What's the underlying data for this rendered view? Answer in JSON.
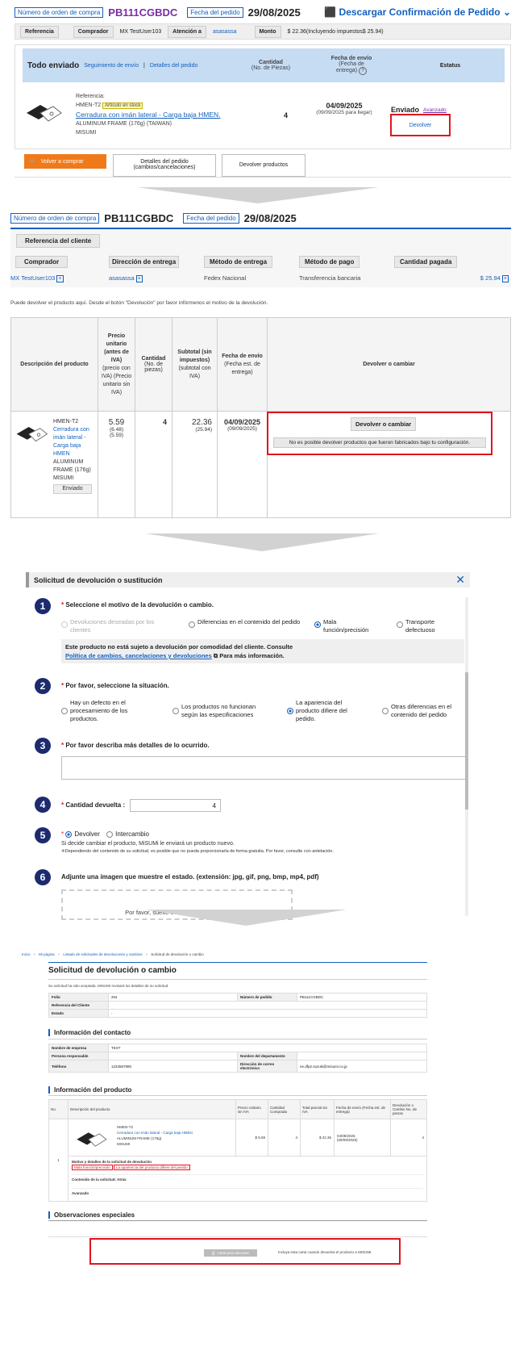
{
  "s1": {
    "order_no_label": "Número de orden de compra",
    "order_no": "PB111CGBDC",
    "order_date_label": "Fecha del pedido",
    "order_date": "29/08/2025",
    "download_label": "Descargar Confirmación de Pedido",
    "ref_label": "Referencia",
    "buyer_label": "Comprador",
    "buyer": "MX TestUser103",
    "attention_label": "Atención a",
    "attention": "asasassa",
    "amount_label": "Monto",
    "amount": "$ 22.36(Incluyendo impuestos$ 25.94)",
    "all_sent": "Todo enviado",
    "tracking": "Seguimiento de envío",
    "sep": "|",
    "details": "Detalles del pedido",
    "qty_h1": "Cantidad",
    "qty_h2": "(No. de Piezas)",
    "ship_h1": "Fecha de envío",
    "ship_h2": "(Fecha de",
    "ship_h3": "entrega)",
    "status_h": "Estatus",
    "ref_text": "Referencia:",
    "code": "HMEN-T2",
    "stock": "Artículo en stock",
    "name": "Cerradura con imán lateral - Carga baja HMEN.",
    "spec": "ALUMINUM FRAME (176g) (TAIWAN)",
    "maker": "MISUMI",
    "qty": "4",
    "ship": "04/09/2025",
    "ship_sub": "(09/09/2025 para llegar)",
    "status": "Enviado",
    "advanced": "Avanzado",
    "return_link": "Devolver",
    "rebuy": "Volver a comprar",
    "order_details_btn": "Detalles del pedido (cambios/cancelaciones)",
    "return_btn": "Devolver productos"
  },
  "s2": {
    "order_no_label": "Número de orden de compra",
    "order_no": "PB111CGBDC",
    "order_date_label": "Fecha del pedido",
    "order_date": "29/08/2025",
    "client_ref": "Referencia del cliente",
    "cols": [
      "Comprador",
      "Dirección de entrega",
      "Método de entrega",
      "Método de pago",
      "Cantidad pagada"
    ],
    "vals": [
      "MX TestUser103",
      "asasassa",
      "Fedex Nacional",
      "Transferencia bancaria",
      "$ 25.94"
    ],
    "note": "Puede devolver el producto aquí. Desde el botón \"Devolución\" por favor infórmenos el motivo de la devolución.",
    "h_desc": "Descripción del producto",
    "h_price": "Precio unitario (antes de IVA)",
    "h_price_sub": "(precio con IVA) (Precio unitario sin IVA)",
    "h_qty": "Cantidad",
    "h_qty_sub": "(No. de piezas)",
    "h_sub": "Subtotal (sin impuestos)",
    "h_sub_sub": "(subtotal con IVA)",
    "h_ship": "Fecha de envío",
    "h_ship_sub": "(Fecha est. de entrega)",
    "h_ret": "Devolver o cambiar",
    "code": "HMEN-T2",
    "name": "Cerradura con imán lateral - Carga baja HMEN",
    "spec": "ALUMINUM FRAME (176g)",
    "maker": "MISUMI",
    "sent": "Enviado",
    "price": "5.59",
    "price_a": "(6.48)",
    "price_b": "(5.59)",
    "qty": "4",
    "sub": "22.36",
    "sub_a": "(25.94)",
    "ship": "04/09/2025",
    "ship_a": "(09/09/2025)",
    "ret_btn": "Devolver o cambiar",
    "ret_msg": "No es posible devolver productos que fueron fabricados bajo tu configuración."
  },
  "s3": {
    "title": "Solicitud de devolución o sustitución",
    "q1": "Seleccione el motivo de la devolución o cambio.",
    "q1_opts": [
      "Devoluciones deseadas por los clientes",
      "Diferencias en el contenido del pedido",
      "Mala función/precisión",
      "Transporte defectuoso"
    ],
    "notice1": "Este producto no está sujeto a devolución por comodidad del cliente. Consulte",
    "notice_link": "Política de cambios, cancelaciones y devoluciones",
    "notice2": "Para más información.",
    "q2": "Por favor, seleccione la situación.",
    "q2_opts": [
      "Hay un defecto en el procesamiento de los productos.",
      "Los productos no funcionan según las especificaciones",
      "La apariencia del producto difiere del pedido.",
      "Otras diferencias en el contenido del pedido"
    ],
    "q3": "Por favor describa más detalles de lo ocurrido.",
    "q4": "Cantidad devuelta :",
    "q4_val": "4",
    "q5_ret": "Devolver",
    "q5_exc": "Intercambio",
    "q5_note1": "Si decide cambiar el producto, MiSUMi le enviará un producto nuevo.",
    "q5_note2": "※Dependiendo del contenido de su solicitud, es posible que no pueda proporcionarla de forma gratuita. Por favor, consulte con antelación.",
    "q6": "Adjunte una imagen que muestre el estado. (extensión: jpg, gif, png, bmp, mp4, pdf)",
    "drop": "Por favor, suelte el archivo y adjúntelo."
  },
  "s4": {
    "bc": [
      "Inicio",
      "Mi página",
      "Listado de solicitudes de devoluciones y cambios",
      "Solicitud de devolución o cambio"
    ],
    "title": "Solicitud de devolución o cambio",
    "accepted": "Su solicitud ha sido aceptada. MISUMI revisará los detalles de su solicitud.",
    "folio_l": "Folio",
    "folio": "204",
    "order_l": "Número de pedido",
    "order": "PB111CGBDC",
    "clientref_l": "Referencia del Cliente",
    "state_l": "Estado",
    "state": "-",
    "contact_h": "Información del contacto",
    "company_l": "Nombre de empresa",
    "company": "TEST",
    "person_l": "Persona responsable",
    "dept_l": "Nombre del departamento",
    "phone_l": "Teléfono",
    "phone": "1234567890",
    "email_l": "Dirección de correo electrónico",
    "email": "ne.dfp2.suzuki@misumi.co.jp",
    "product_h": "Información del producto",
    "cols": [
      "No.",
      "Descripción del producto",
      "Precio unitario sin IVA",
      "Cantidad Comprada",
      "Total parcial sin IVA",
      "Fecha de envío (Fecha est. de entrega)",
      "Devolución o Cambio No. de piezas"
    ],
    "row_no": "1",
    "code": "HMEN-T2",
    "name": "Cerradura con imán lateral - Carga baja HMEN",
    "spec": "ALUMINUM FRAME (176g)",
    "maker": "MISUMI",
    "price": "$ 5.59",
    "qty": "4",
    "total": "$ 22.36",
    "ship": "04/09/2025",
    "ship2": "(09/09/2025)",
    "ret_qty": "4",
    "reason_l": "Motivo y detalles de la solicitud de devolución",
    "tag1": "Mala función/precisión",
    "tag2": "La apariencia del producto difiere del pedido",
    "content_l": "Contenido de la solicitud:",
    "content": "Atrás",
    "adv_l": "Avanzado",
    "obs_h": "Observaciones especiales",
    "letter_btn": "Carta para devolver",
    "letter_note": "Incluya esta carta cuando devuelva el producto a MISUMI."
  },
  "colors": {
    "accent": "#1560bd",
    "purple": "#7b2ca3",
    "red": "#e0141e",
    "orange": "#f07a1a",
    "navy": "#1d2b6e"
  }
}
